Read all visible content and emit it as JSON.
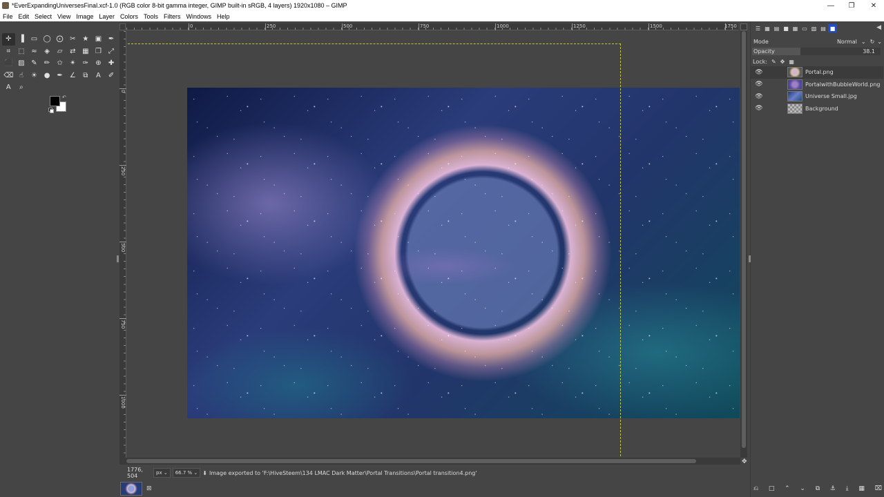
{
  "window": {
    "title": "*EverExpandingUniversesFinal.xcf-1.0 (RGB color 8-bit gamma integer, GIMP built-in sRGB, 4 layers) 1920x1080 – GIMP",
    "minimize": "—",
    "maximize": "❐",
    "close": "✕"
  },
  "menubar": [
    "File",
    "Edit",
    "Select",
    "View",
    "Image",
    "Layer",
    "Colors",
    "Tools",
    "Filters",
    "Windows",
    "Help"
  ],
  "toolbox": {
    "tools": [
      {
        "name": "move-tool-icon",
        "glyph": "✛"
      },
      {
        "name": "align-tool-icon",
        "glyph": "▐"
      },
      {
        "name": "rect-select-icon",
        "glyph": "▭"
      },
      {
        "name": "ellipse-select-icon",
        "glyph": "◯"
      },
      {
        "name": "free-select-icon",
        "glyph": "⨀"
      },
      {
        "name": "scissors-select-icon",
        "glyph": "✂"
      },
      {
        "name": "fuzzy-select-icon",
        "glyph": "★"
      },
      {
        "name": "foreground-select-icon",
        "glyph": "▣"
      },
      {
        "name": "paths-tool-icon",
        "glyph": "✒"
      },
      {
        "name": "crop-tool-icon",
        "glyph": "⌗"
      },
      {
        "name": "unified-transform-icon",
        "glyph": "⬚"
      },
      {
        "name": "warp-transform-icon",
        "glyph": "≈"
      },
      {
        "name": "cage-transform-icon",
        "glyph": "◈"
      },
      {
        "name": "perspective-tool-icon",
        "glyph": "▱"
      },
      {
        "name": "flip-tool-icon",
        "glyph": "⇄"
      },
      {
        "name": "handle-transform-icon",
        "glyph": "▦"
      },
      {
        "name": "text-orientation-icon",
        "glyph": "❐"
      },
      {
        "name": "scale-tool-icon",
        "glyph": "⤢"
      },
      {
        "name": "bucket-fill-icon",
        "glyph": "⬛"
      },
      {
        "name": "gradient-tool-icon",
        "glyph": "▨"
      },
      {
        "name": "paintbrush-icon",
        "glyph": "✎"
      },
      {
        "name": "pencil-icon",
        "glyph": "✏"
      },
      {
        "name": "airbrush-icon",
        "glyph": "✩"
      },
      {
        "name": "mypaint-brush-icon",
        "glyph": "✴"
      },
      {
        "name": "ink-tool-icon",
        "glyph": "✑"
      },
      {
        "name": "clone-tool-icon",
        "glyph": "⊕"
      },
      {
        "name": "heal-tool-icon",
        "glyph": "✚"
      },
      {
        "name": "eraser-icon",
        "glyph": "⌫"
      },
      {
        "name": "smudge-tool-icon",
        "glyph": "☝"
      },
      {
        "name": "dodge-burn-icon",
        "glyph": "☀"
      },
      {
        "name": "blur-sharpen-icon",
        "glyph": "●"
      },
      {
        "name": "color-picker-icon",
        "glyph": "✒"
      },
      {
        "name": "measure-tool-icon",
        "glyph": "∠"
      },
      {
        "name": "clone-perspective-icon",
        "glyph": "⧉"
      },
      {
        "name": "text-tool-icon",
        "glyph": "A"
      },
      {
        "name": "eyedropper-icon",
        "glyph": "✐"
      },
      {
        "name": "warp-text-icon",
        "glyph": "A"
      },
      {
        "name": "zoom-tool-icon",
        "glyph": "⌕"
      }
    ],
    "colors": {
      "foreground": "#000000",
      "background": "#ffffff"
    }
  },
  "canvas": {
    "h_ruler_labels": [
      "0",
      "250",
      "500",
      "750",
      "1000",
      "1250",
      "1500",
      "1750"
    ],
    "v_ruler_labels": [
      "0",
      "250",
      "500",
      "750",
      "1000"
    ],
    "boundary_color": "#c8c830"
  },
  "statusbar": {
    "coords": "1776, 504",
    "unit": "px",
    "zoom": "66.7 %",
    "message": "Image exported to 'F:\\HiveSteem\\134 LMAC Dark Matter\\Portal Transitions\\Portal transition4.png'"
  },
  "layers_panel": {
    "mode_label": "Mode",
    "mode_value": "Normal",
    "opacity_label": "Opacity",
    "opacity_value": "38.1",
    "lock_label": "Lock:",
    "layers": [
      {
        "name": "Portal.png",
        "thumb": "portal",
        "selected": true
      },
      {
        "name": "PortalwithBubbleWorld.png",
        "thumb": "bubble",
        "selected": false
      },
      {
        "name": "Universe Small.jpg",
        "thumb": "universe",
        "selected": false
      },
      {
        "name": "Background",
        "thumb": "background",
        "selected": false
      }
    ]
  }
}
